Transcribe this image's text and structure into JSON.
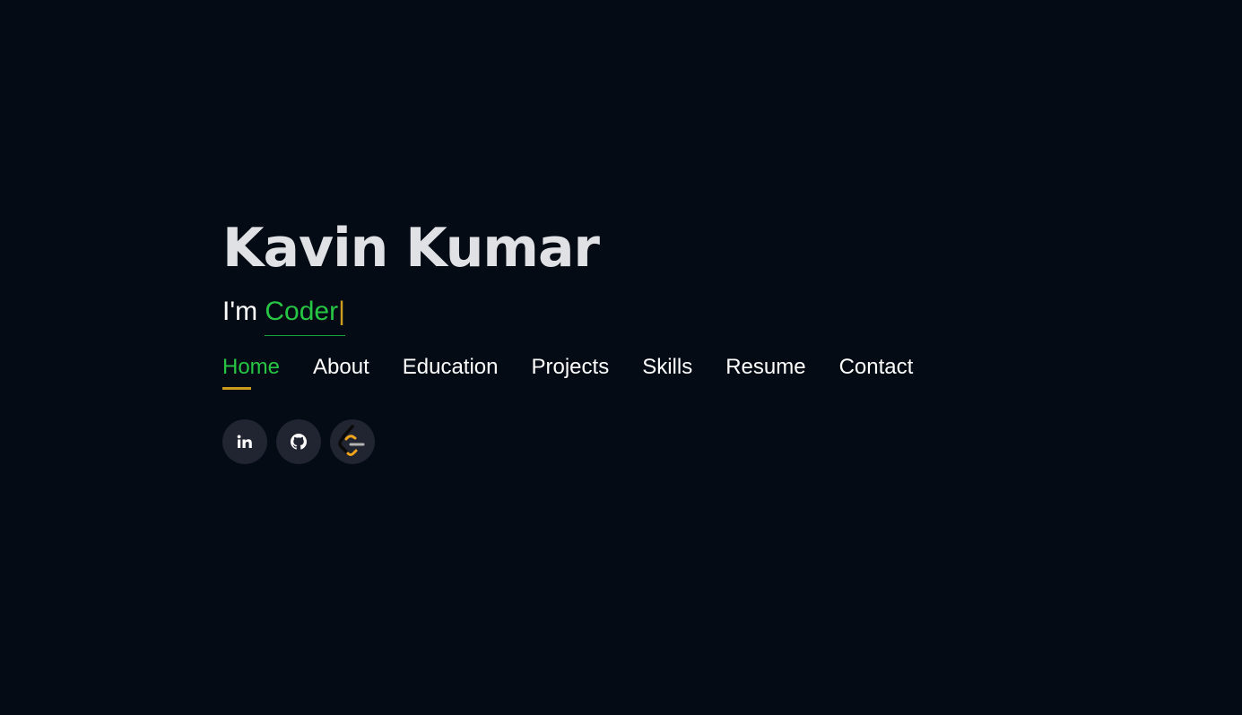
{
  "hero": {
    "name": "Kavin Kumar",
    "tagline_prefix": "I'm ",
    "typed_text": "Coder",
    "cursor": "|"
  },
  "nav": {
    "items": [
      {
        "label": "Home",
        "active": true
      },
      {
        "label": "About",
        "active": false
      },
      {
        "label": "Education",
        "active": false
      },
      {
        "label": "Projects",
        "active": false
      },
      {
        "label": "Skills",
        "active": false
      },
      {
        "label": "Resume",
        "active": false
      },
      {
        "label": "Contact",
        "active": false
      }
    ]
  },
  "social": {
    "links": [
      {
        "icon": "linkedin-icon"
      },
      {
        "icon": "github-icon"
      },
      {
        "icon": "leetcode-icon"
      }
    ]
  },
  "colors": {
    "background": "#040b14",
    "accent_green": "#26c644",
    "accent_gold": "#cc9d1c",
    "name_color": "#dfe1e5",
    "social_bg": "#212431"
  }
}
